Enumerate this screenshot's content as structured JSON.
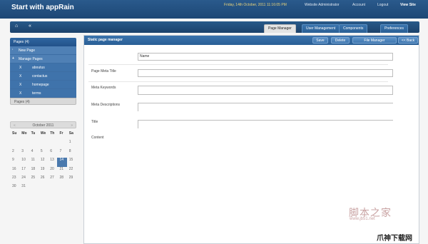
{
  "header": {
    "title": "Start with appRain",
    "date": "Friday, 14th October, 2011 11:16:05 PM",
    "links": [
      "Website Administrator",
      "Account",
      "Logout",
      "View Site"
    ]
  },
  "nav": {
    "home_icon": "home-icon",
    "collapse_icon": "«",
    "tabs": [
      "Page Manager",
      "User Management",
      "Components",
      "Preferences"
    ],
    "active_tab": "Page Manager"
  },
  "sidebar": {
    "header": "Pages (4)",
    "new_page": "New Page",
    "manage_pages": "Manage Pages",
    "pages": [
      {
        "mark": "X",
        "label": "aboutus"
      },
      {
        "mark": "X",
        "label": "contactus"
      },
      {
        "mark": "X",
        "label": "homepage"
      },
      {
        "mark": "X",
        "label": "terms"
      }
    ],
    "footer": "Pages (4)"
  },
  "calendar": {
    "month": "October 2011",
    "prev": "«",
    "next": "»",
    "dow": [
      "Su",
      "Mo",
      "Tu",
      "We",
      "Th",
      "Fr",
      "Sa"
    ],
    "days": [
      "",
      "",
      "",
      "",
      "",
      "",
      "1",
      "2",
      "3",
      "4",
      "5",
      "6",
      "7",
      "8",
      "9",
      "10",
      "11",
      "12",
      "13",
      "14",
      "15",
      "16",
      "17",
      "18",
      "19",
      "20",
      "21",
      "22",
      "23",
      "24",
      "25",
      "26",
      "27",
      "28",
      "29",
      "30",
      "31",
      "",
      "",
      "",
      "",
      ""
    ],
    "today": "14"
  },
  "main": {
    "title": "Static page manager",
    "buttons": [
      "Save",
      "Delete",
      "File Manager",
      "<< Back"
    ],
    "fields": {
      "name_value": "Name",
      "page_meta_title": "Page Meta Title",
      "meta_keywords": "Meta Keywords",
      "meta_descriptions": "Meta Descriptions",
      "title": "Title",
      "content": "Content"
    }
  },
  "watermark": {
    "line1": "脚本之家",
    "line2": "www.jb51.net",
    "line3": "爪神下载网"
  }
}
